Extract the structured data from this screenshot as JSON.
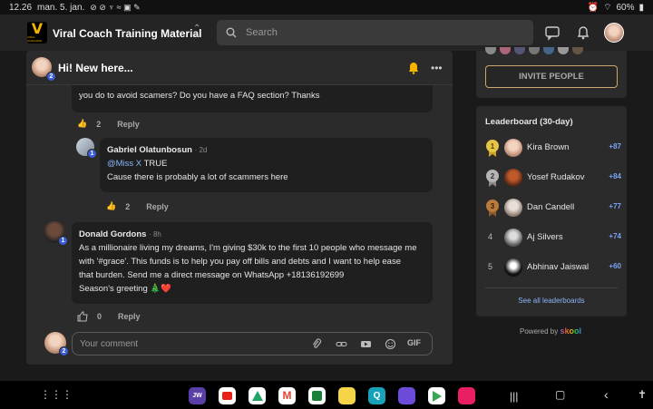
{
  "statusbar": {
    "time": "12.26",
    "date": "man. 5. jan.",
    "battery": "60%"
  },
  "topbar": {
    "community_name": "Viral Coach Training Material",
    "logo_text": "VIRAL COACHING",
    "search_placeholder": "Search"
  },
  "post": {
    "title": "Hi! New here...",
    "author_level": "2"
  },
  "thread": {
    "partial_comment_text": "you do to avoid scamers? Do you have a FAQ section? Thanks",
    "partial_likes": "2",
    "reply_label": "Reply",
    "replies": [
      {
        "author": "Gabriel Olatunbosun",
        "time": "2d",
        "level": "1",
        "mention": "@Miss X",
        "line1_rest": " TRUE",
        "line2": "Cause there is probably a lot of scammers here",
        "likes": "2"
      }
    ],
    "comments": [
      {
        "author": "Donald Gordons",
        "time": "8h",
        "level": "1",
        "lines": [
          "As a millionaire living my dreams, I'm giving $30k to the first 10 people who message me",
          "with '#grace'. This funds is to help you pay off bills and debts and I want to help ease",
          "that burden. Send me a direct message on WhatsApp +18136192699",
          "Season's greeting 🎄❤️"
        ],
        "likes": "0"
      }
    ]
  },
  "composer": {
    "placeholder": "Your comment",
    "gif_label": "GIF",
    "user_level": "2"
  },
  "invite": {
    "label": "INVITE PEOPLE"
  },
  "leaderboard": {
    "title": "Leaderboard (30-day)",
    "entries": [
      {
        "rank": "1",
        "name": "Kira Brown",
        "points": "+87"
      },
      {
        "rank": "2",
        "name": "Yosef Rudakov",
        "points": "+84"
      },
      {
        "rank": "3",
        "name": "Dan Candell",
        "points": "+77"
      },
      {
        "rank": "4",
        "name": "Aj Silvers",
        "points": "+74"
      },
      {
        "rank": "5",
        "name": "Abhinav Jaiswal",
        "points": "+60"
      }
    ],
    "see_all": "See all leaderboards"
  },
  "powered": {
    "prefix": "Powered by",
    "brand": "skool"
  },
  "colors": {
    "accent_gold": "#c9a86a",
    "link_blue": "#8ab4f8",
    "level_badge": "#3b5bdb"
  }
}
